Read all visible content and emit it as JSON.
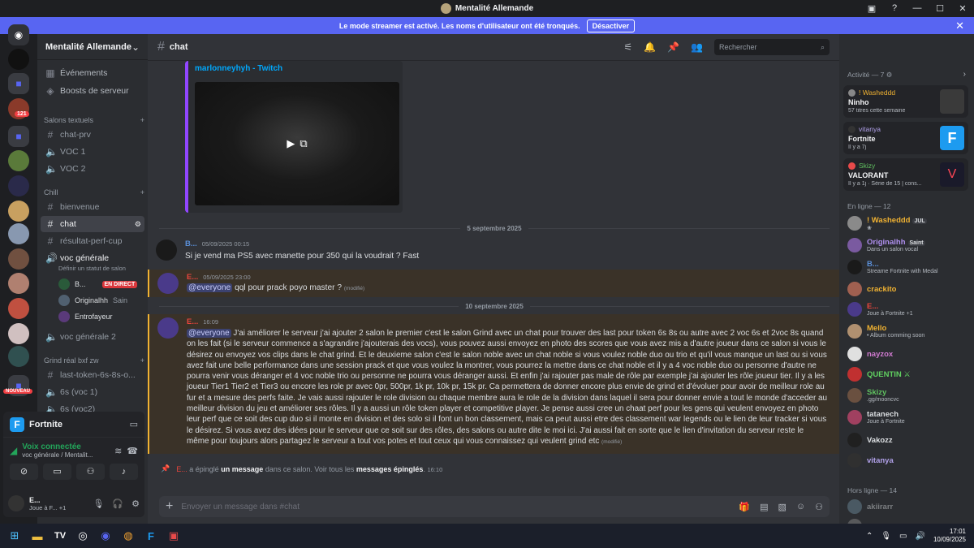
{
  "window": {
    "title": "Mentalité Allemande"
  },
  "banner": {
    "text": "Le mode streamer est activé. Les noms d'utilisateur ont été tronqués.",
    "button": "Désactiver"
  },
  "server": {
    "name": "Mentalité Allemande"
  },
  "guilds": {
    "badge_121": "121",
    "badge_new": "NOUVEAU"
  },
  "sidebar": {
    "events": "Événements",
    "boosts": "Boosts de serveur",
    "cat_text": "Salons textuels",
    "cat_chill": "Chill",
    "cat_grind": "Grind réal bxf zw",
    "channels": {
      "chat_prv": "chat-prv",
      "voc1": "VOC 1",
      "voc2": "VOC 2",
      "bienvenue": "bienvenue",
      "chat": "chat",
      "resultat": "résultat-perf-cup",
      "voc_generale": "voc générale",
      "voc_status": "Définir un statut de salon",
      "voc_generale2": "voc générale 2",
      "last_token": "last-token-6s-8s-o...",
      "six_voc1": "6s (voc 1)",
      "six_voc2": "6s (voc2)"
    },
    "voice_users": [
      {
        "name": "B...",
        "live": "EN DIRECT"
      },
      {
        "name": "Originalhh",
        "tag": "Sain"
      },
      {
        "name": "Entrofayeur"
      }
    ]
  },
  "panel": {
    "game": "Fortnite",
    "voice_title": "Voix connectée",
    "voice_sub": "voc générale / Mentalit...",
    "user_name": "E...",
    "user_status": "Joue à F...",
    "user_extra": "+1"
  },
  "chat": {
    "channel": "chat",
    "search": "Rechercher",
    "embed_link": "marlonneyhyh - Twitch",
    "composer": "Envoyer un message dans #chat"
  },
  "dividers": [
    "5 septembre 2025",
    "10 septembre 2025"
  ],
  "messages": [
    {
      "author": "B...",
      "time": "05/09/2025 00:15",
      "text": "Si je vend ma PS5 avec manette pour 350 qui la voudrait ? Fast"
    },
    {
      "author": "E...",
      "time": "05/09/2025 23:00",
      "mention": "@everyone",
      "text": " qql pour prack poyo master ? ",
      "edited": "(modifié)"
    },
    {
      "author": "E...",
      "time": "16:09",
      "mention": "@everyone",
      "text": " J'ai améliorer le serveur j'ai ajouter 2 salon le premier c'est le salon Grind avec un chat pour trouver des last pour token 6s 8s ou autre avec 2 voc 6s et 2voc 8s quand on les fait (si le serveur commence a s'agrandire j'ajouterais des vocs), vous pouvez aussi envoyez en photo des scores que vous avez mis a d'autre joueur dans ce salon si vous le désirez ou envoyez vos clips dans le chat grind. Et le deuxieme salon c'est le salon noble avec un chat noble si vous voulez noble duo ou trio et qu'il vous manque un last ou si vous avez fait une belle performance dans une session prack et que vous voulez la montrer, vous pourrez la mettre dans ce chat noble et il y a 4 voc noble duo ou personne d'autre ne pourra venir vous déranger et 4 voc noble trio ou personne ne pourra vous déranger aussi. Et enfin j'ai rajouter pas male de rôle par exemple j'ai ajouter les rôle joueur tier. Il y a les joueur Tier1 Tier2 et Tier3 ou encore les role pr avec 0pr, 500pr, 1k pr, 10k pr, 15k pr. Ca permettera de donner encore plus envie de grind et d'évoluer pour avoir de meilleur role au fur et a mesure des perfs faite. Je vais aussi rajouter le role division ou chaque membre aura le role de la division dans laquel il sera pour donner envie a tout le monde d'acceder au meilleur division du jeu et améliorer ses rôles. Il y a aussi un rôle token player et competitive player. Je pense aussi cree un chaat perf pour les gens qui veulent envoyez en photo leur perf que ce soit des cup duo si il monte en division et des solo si il font un bon classement, mais ca peut aussi etre des classement war legends ou le lien de leur tracker si vous le désirez. Si vous avez des idées pour le serveur que ce soit sur des rôles, des salons ou autre dite le moi ici. J'ai aussi fait en sorte que le lien d'invitation du serveur reste le même pour toujours alors partagez le serveur a tout vos potes et tout ceux qui vous connaissez qui veulent grind etc ",
      "edited": "(modifié)"
    }
  ],
  "pin": {
    "author": "E...",
    "a": " a épinglé ",
    "b": "un message",
    "c": " dans ce salon. Voir tous les ",
    "d": "messages épinglés",
    "e": ".",
    "time": "16:10"
  },
  "members": {
    "activity_title": "Activité — 7",
    "activity": [
      {
        "name": "! Washeddd",
        "game": "Ninho",
        "detail": "57 titres cette semaine"
      },
      {
        "name": "vitanya",
        "game": "Fortnite",
        "detail": "Il y a 7j"
      },
      {
        "name": "Skizy",
        "game": "VALORANT",
        "detail": "Il y a 1j · Série de 15 | cons..."
      }
    ],
    "online_title": "En ligne — 12",
    "online": [
      {
        "name": "! Washeddd",
        "tag": "JUL",
        "status": "❀"
      },
      {
        "name": "Originalhh",
        "tag": "Saint",
        "status": "Dans un salon vocal"
      },
      {
        "name": "B...",
        "status": "Streame Fortnite with Medal"
      },
      {
        "name": "crackito"
      },
      {
        "name": "E...",
        "status": "Joue à Fortnite +1"
      },
      {
        "name": "Mello",
        "status": "• Album comming soon"
      },
      {
        "name": "nayzox"
      },
      {
        "name": "QUENTIN ⚔"
      },
      {
        "name": "Skizy",
        "status": ".gg/mooncvc"
      },
      {
        "name": "tatanech",
        "status": "Joue à Fortnite"
      },
      {
        "name": "Vakozz"
      },
      {
        "name": "vitanya"
      }
    ],
    "offline_title": "Hors ligne — 14",
    "offline": [
      {
        "name": "akiirarr"
      },
      {
        "name": ""
      }
    ]
  },
  "taskbar": {
    "time": "17:01",
    "date": "10/09/2025"
  }
}
